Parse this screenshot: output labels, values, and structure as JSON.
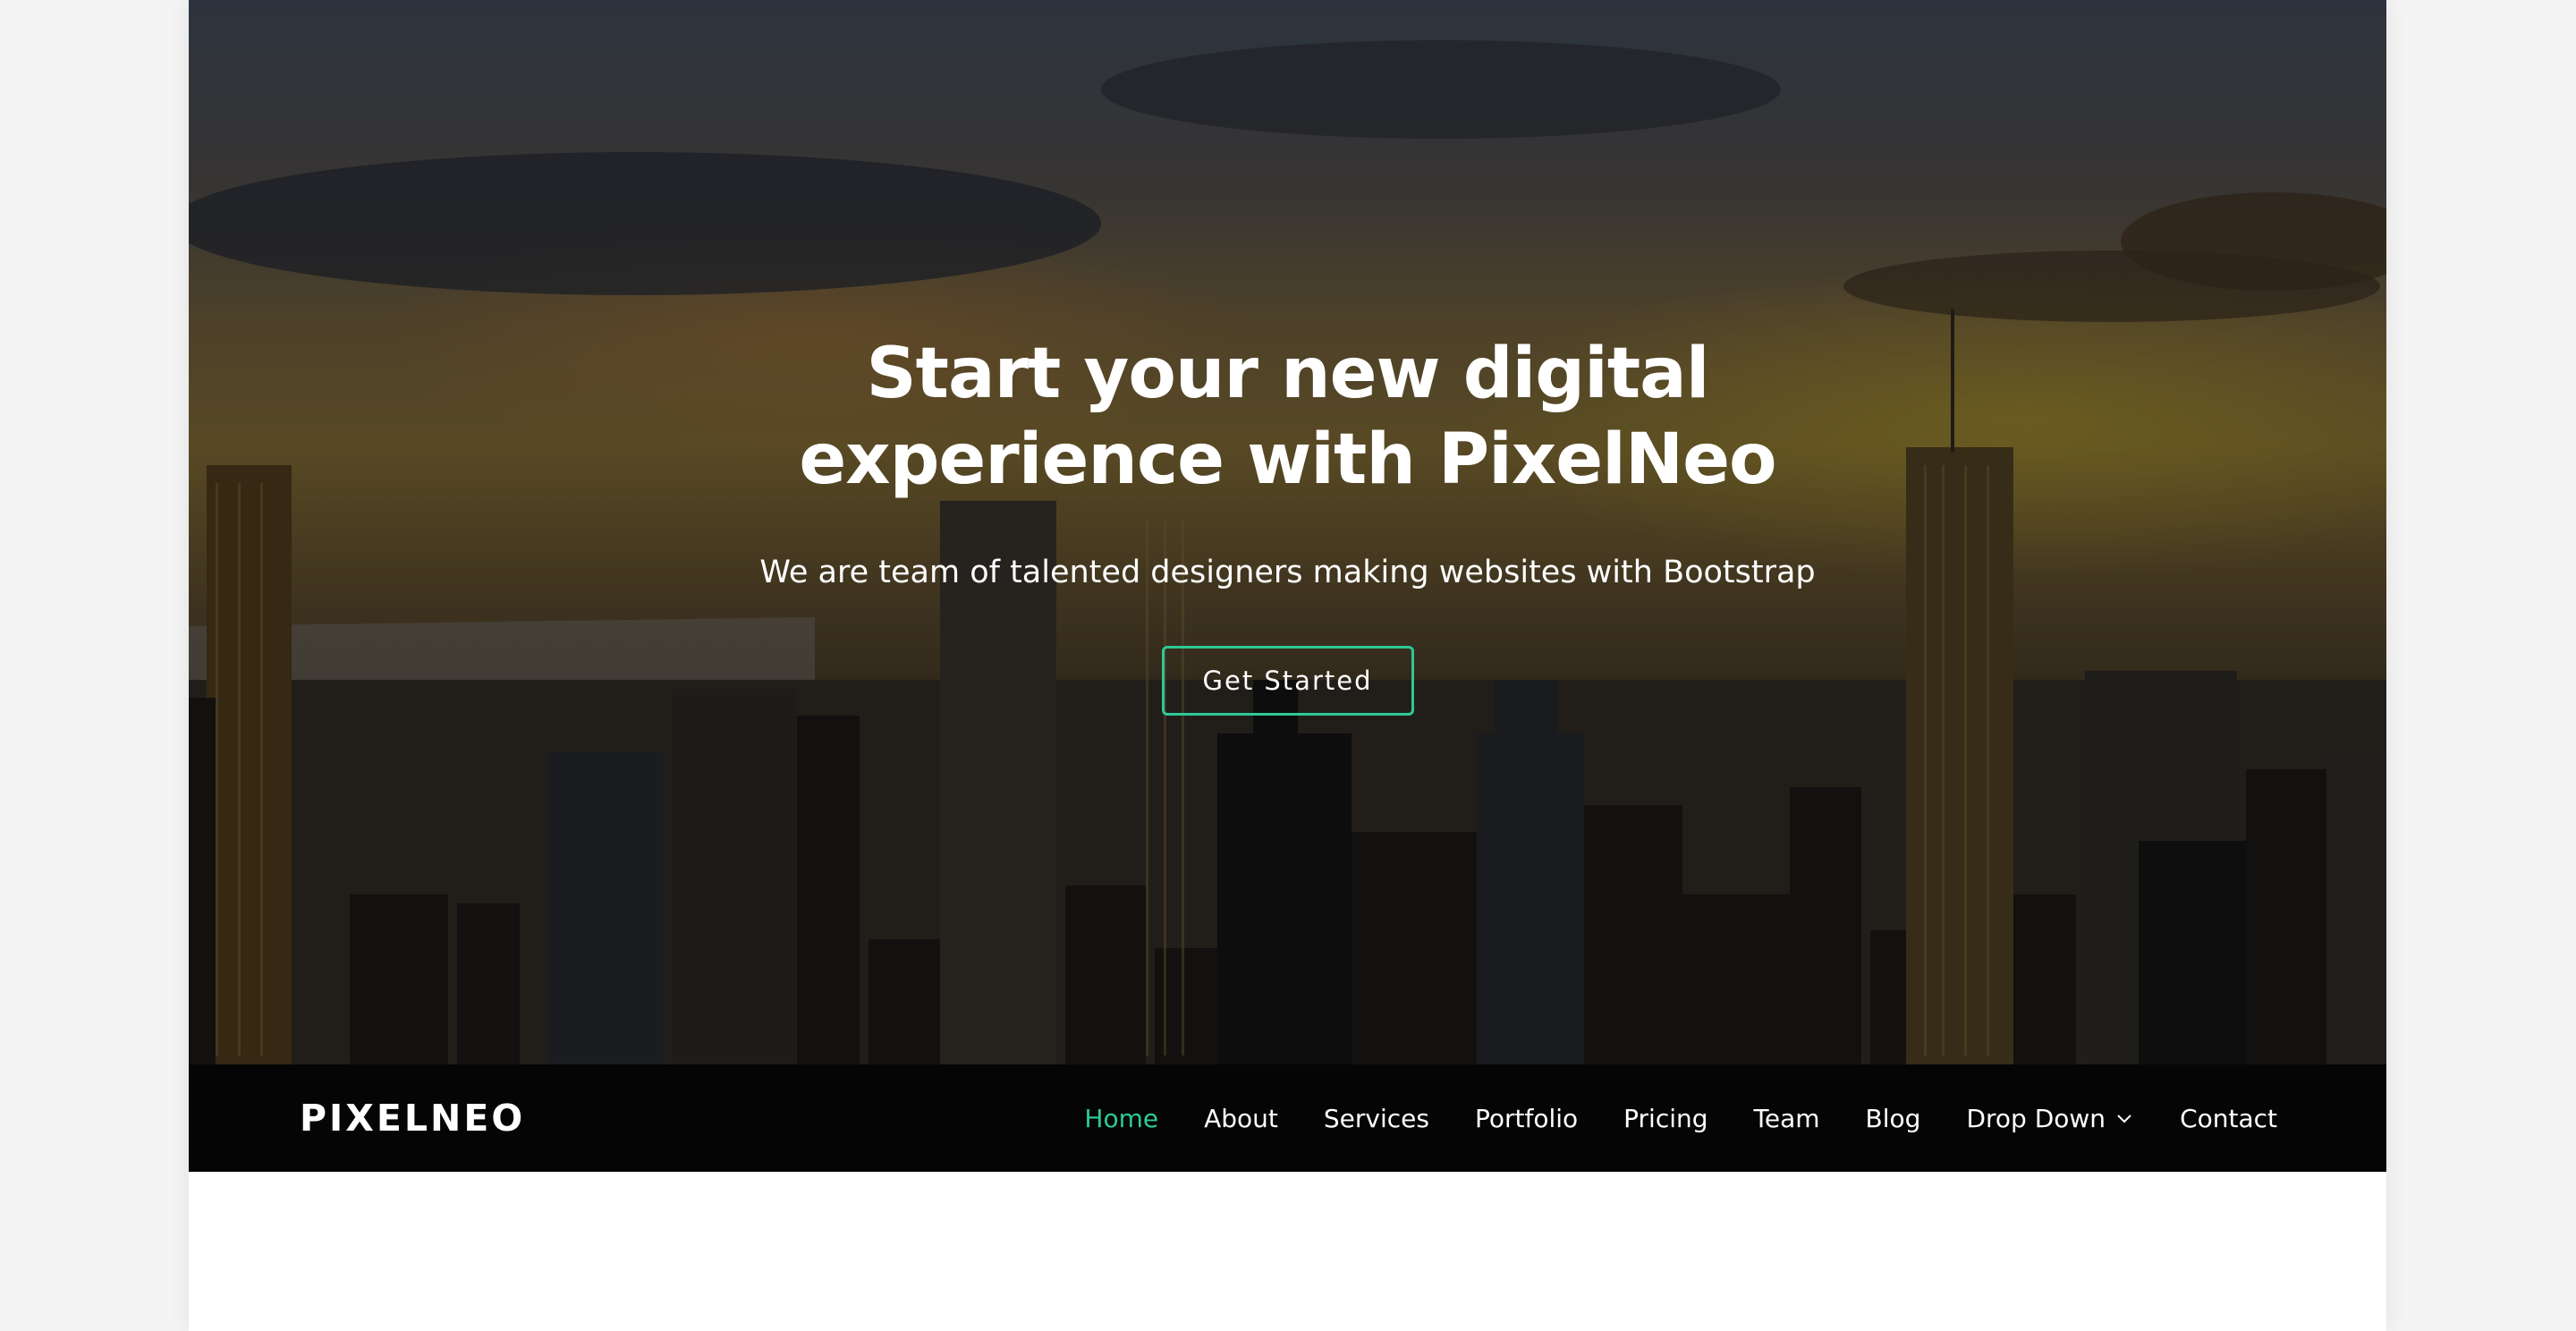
{
  "hero": {
    "title_line1": "Start your new digital",
    "title_line2": "experience with PixelNeo",
    "subtitle": "We are team of talented designers making websites with Bootstrap",
    "cta_label": "Get Started"
  },
  "navbar": {
    "logo": "PIXELNEO",
    "items": [
      {
        "label": "Home",
        "active": true
      },
      {
        "label": "About"
      },
      {
        "label": "Services"
      },
      {
        "label": "Portfolio"
      },
      {
        "label": "Pricing"
      },
      {
        "label": "Team"
      },
      {
        "label": "Blog"
      },
      {
        "label": "Drop Down",
        "icon": "chevron-down-icon"
      },
      {
        "label": "Contact"
      }
    ]
  },
  "colors": {
    "accent": "#2dc997",
    "navbar_bg": "#050505",
    "page_bg": "#ffffff",
    "outer_bg": "#f4f4f4"
  }
}
